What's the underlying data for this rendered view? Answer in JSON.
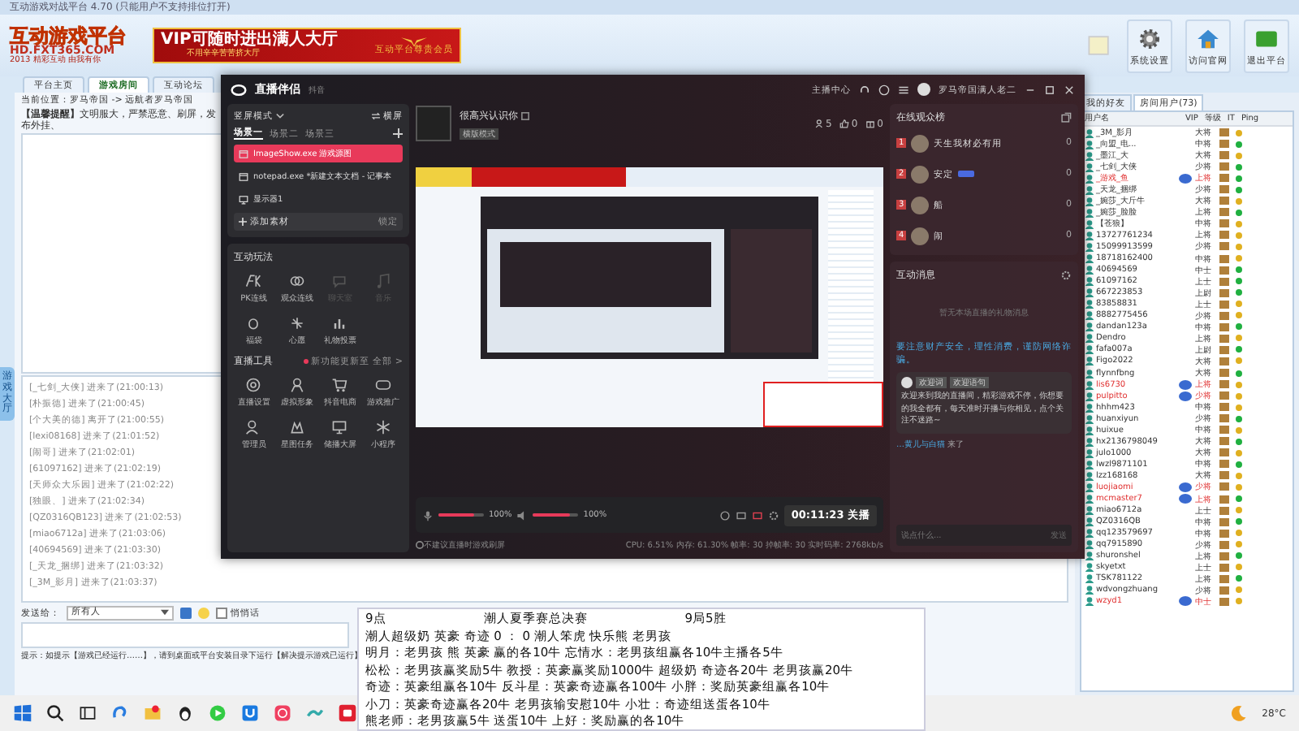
{
  "app": {
    "title": "互动游戏对战平台 4.70 (只能用户不支持排位打开)",
    "logo": {
      "name": "互动游戏平台",
      "site": "HD.FXT365.COM",
      "slogan": "2013 精彩互动 由我有你"
    },
    "banner": {
      "headline": "VIP可随时进出满人大厅",
      "subline": "不用辛辛苦苦挤大厅",
      "badge": "互动平台尊贵会员"
    },
    "toolbar": [
      {
        "label": "系统设置",
        "kind": "gear"
      },
      {
        "label": "访问官网",
        "kind": "home"
      },
      {
        "label": "退出平台",
        "kind": "exit"
      }
    ],
    "tabs": [
      {
        "label": "平台主页",
        "selected": false
      },
      {
        "label": "游戏房间",
        "selected": true
      },
      {
        "label": "互动论坛",
        "selected": false
      }
    ],
    "side_tab": "游戏大厅",
    "location": "当前位置：罗马帝国 -> 远航者罗马帝国",
    "notice": {
      "label": "【温馨提醒】",
      "text": "文明服大，严禁恶意、刷屏，发布外挂、"
    },
    "log": [
      "[_七剑_大侠] 进来了(21:00:13)",
      "[朴振德] 进来了(21:00:45)",
      "[个大美的德] 离开了(21:00:55)",
      "[lexi08168] 进来了(21:01:52)",
      "[闹哥] 进来了(21:02:01)",
      "[61097162] 进来了(21:02:19)",
      "[天师众大乐园] 进来了(21:02:22)",
      "[独眼、] 进来了(21:02:34)",
      "[QZ0316QB123] 进来了(21:02:53)",
      "[miao6712a] 进来了(21:03:06)",
      "[40694569] 进来了(21:03:30)",
      "[_天龙_捆绑] 进来了(21:03:32)",
      "[_3M_影月] 进来了(21:03:37)"
    ],
    "send": {
      "label": "发送给：",
      "value": "所有人",
      "whisper": {
        "label": "悄悄话",
        "checked": false
      }
    },
    "hint": "提示：如提示【游戏已经运行……】，请到桌面或平台安装目录下运行【解决提示游戏已运行】",
    "user_tabs": [
      {
        "label": "我的好友",
        "selected": false
      },
      {
        "label": "房间用户(73)",
        "selected": true
      }
    ],
    "user_columns": [
      "用户名",
      "VIP",
      "等级",
      "IT",
      "Ping"
    ],
    "users": [
      {
        "name": "_3M_影月",
        "level": "大将",
        "vip": false,
        "color": "#e0b020"
      },
      {
        "name": "_向盟_电...",
        "level": "中将",
        "vip": false,
        "color": "#20b040"
      },
      {
        "name": "_墨江_大",
        "level": "大将",
        "vip": false,
        "color": "#e0b020"
      },
      {
        "name": "_七剑_大侠",
        "level": "少将",
        "vip": false,
        "color": "#20b040"
      },
      {
        "name": "_游戏_鱼",
        "level": "上将",
        "vip": true,
        "color": "#20b040"
      },
      {
        "name": "_天龙_捆绑",
        "level": "少将",
        "vip": false,
        "color": "#20b040"
      },
      {
        "name": "_婉莎_大斤牛",
        "level": "大将",
        "vip": false,
        "color": "#e0b020"
      },
      {
        "name": "_婉莎_脸脸",
        "level": "上将",
        "vip": false,
        "color": "#20b040"
      },
      {
        "name": "【苍狼】",
        "level": "中将",
        "vip": false,
        "color": "#e0b020"
      },
      {
        "name": "13727761234",
        "level": "上将",
        "vip": false,
        "color": "#e0b020"
      },
      {
        "name": "15099913599",
        "level": "少将",
        "vip": false,
        "color": "#e0b020"
      },
      {
        "name": "18718162400",
        "level": "中将",
        "vip": false,
        "color": "#e0b020"
      },
      {
        "name": "40694569",
        "level": "中士",
        "vip": false,
        "color": "#20b040"
      },
      {
        "name": "61097162",
        "level": "上士",
        "vip": false,
        "color": "#20b040"
      },
      {
        "name": "667223853",
        "level": "上尉",
        "vip": false,
        "color": "#20b040"
      },
      {
        "name": "83858831",
        "level": "上士",
        "vip": false,
        "color": "#e0b020"
      },
      {
        "name": "8882775456",
        "level": "少将",
        "vip": false,
        "color": "#e0b020"
      },
      {
        "name": "dandan123a",
        "level": "中将",
        "vip": false,
        "color": "#20b040"
      },
      {
        "name": "Dendro",
        "level": "上将",
        "vip": false,
        "color": "#e0b020"
      },
      {
        "name": "fafa007a",
        "level": "上尉",
        "vip": false,
        "color": "#20b040"
      },
      {
        "name": "Figo2022",
        "level": "大将",
        "vip": false,
        "color": "#e0b020"
      },
      {
        "name": "flynnfbng",
        "level": "大将",
        "vip": false,
        "color": "#20b040"
      },
      {
        "name": "lis6730",
        "level": "上将",
        "vip": true,
        "color": "#e0b020"
      },
      {
        "name": "pulpitto",
        "level": "少将",
        "vip": true,
        "color": "#e0b020"
      },
      {
        "name": "hhhm423",
        "level": "中将",
        "vip": false,
        "color": "#e0b020"
      },
      {
        "name": "huanxiyun",
        "level": "少将",
        "vip": false,
        "color": "#20b040"
      },
      {
        "name": "huixue",
        "level": "中将",
        "vip": false,
        "color": "#e0b020"
      },
      {
        "name": "hx2136798049",
        "level": "大将",
        "vip": false,
        "color": "#20b040"
      },
      {
        "name": "julo1000",
        "level": "大将",
        "vip": false,
        "color": "#e0b020"
      },
      {
        "name": "lwzl9871101",
        "level": "中将",
        "vip": false,
        "color": "#20b040"
      },
      {
        "name": "lzz168168",
        "level": "大将",
        "vip": false,
        "color": "#e0b020"
      },
      {
        "name": "luojiaomi",
        "level": "少将",
        "vip": true,
        "color": "#e0b020"
      },
      {
        "name": "mcmaster7",
        "level": "上将",
        "vip": true,
        "color": "#20b040"
      },
      {
        "name": "miao6712a",
        "level": "上士",
        "vip": false,
        "color": "#e0b020"
      },
      {
        "name": "QZ0316QB",
        "level": "中将",
        "vip": false,
        "color": "#20b040"
      },
      {
        "name": "qq123579697",
        "level": "中将",
        "vip": false,
        "color": "#e0b020"
      },
      {
        "name": "qq7915890",
        "level": "少将",
        "vip": false,
        "color": "#e0b020"
      },
      {
        "name": "shuronshel",
        "level": "上将",
        "vip": false,
        "color": "#20b040"
      },
      {
        "name": "skyetxt",
        "level": "上士",
        "vip": false,
        "color": "#e0b020"
      },
      {
        "name": "TSK781122",
        "level": "上将",
        "vip": false,
        "color": "#20b040"
      },
      {
        "name": "wdvongzhuang",
        "level": "少将",
        "vip": false,
        "color": "#e0b020"
      },
      {
        "name": "wzyd1",
        "level": "中士",
        "vip": true,
        "color": "#e0b020"
      }
    ]
  },
  "streamer": {
    "brand": "直播伴侣",
    "platform": "抖音",
    "center": "主播中心",
    "user": "罗马帝国满人老二",
    "mode": "竖屏模式",
    "switch": "横屏",
    "scenes": [
      {
        "label": "场景一",
        "selected": true
      },
      {
        "label": "场景二",
        "selected": false
      },
      {
        "label": "场景三",
        "selected": false
      }
    ],
    "sources": [
      {
        "label": "ImageShow.exe 游戏源图",
        "kind": "window",
        "selected": true
      },
      {
        "label": "notepad.exe *新建文本文档 - 记事本",
        "kind": "window",
        "selected": false
      },
      {
        "label": "显示器1",
        "kind": "monitor",
        "selected": false
      }
    ],
    "add_source": "添加素材",
    "lock": "锁定",
    "play_title": "互动玩法",
    "play": [
      {
        "label": "PK连线",
        "kind": "pk",
        "disabled": false
      },
      {
        "label": "观众连线",
        "kind": "link",
        "disabled": false
      },
      {
        "label": "聊天室",
        "kind": "chat",
        "disabled": true
      },
      {
        "label": "音乐",
        "kind": "music",
        "disabled": true
      },
      {
        "label": "福袋",
        "kind": "bag",
        "disabled": false
      },
      {
        "label": "心愿",
        "kind": "wish",
        "disabled": false
      },
      {
        "label": "礼物投票",
        "kind": "vote",
        "disabled": false
      }
    ],
    "tools_title": "直播工具",
    "tools_note": "新功能更新至",
    "tools_all": "全部 >",
    "tools": [
      {
        "label": "直播设置",
        "kind": "settings"
      },
      {
        "label": "虚拟形象",
        "kind": "avatar"
      },
      {
        "label": "抖音电商",
        "kind": "cart"
      },
      {
        "label": "游戏推广",
        "kind": "gamepad"
      },
      {
        "label": "管理员",
        "kind": "admin"
      },
      {
        "label": "星图任务",
        "kind": "task"
      },
      {
        "label": "储播大屏",
        "kind": "screen"
      },
      {
        "label": "小程序",
        "kind": "app"
      }
    ],
    "room": {
      "title": "很高兴认识你",
      "tag": "横版模式"
    },
    "stats": [
      {
        "kind": "viewers",
        "value": "5"
      },
      {
        "kind": "likes",
        "value": "0"
      },
      {
        "kind": "gifts",
        "value": "0"
      }
    ],
    "mic": {
      "level": 0.8,
      "reading": "100%"
    },
    "speaker": {
      "level": 0.8,
      "reading": "100%"
    },
    "timer": "00:11:23",
    "end": "关播",
    "tip": "不建议直播时游戏刷屏",
    "perf": "CPU: 6.51%   内存: 61.30%   帧率: 30   掉帧率: 30   实时码率: 2768kb/s",
    "rank_title": "在线观众榜",
    "rank": [
      {
        "rank": "1",
        "name": "天生我材必有用",
        "badge": false,
        "score": "0"
      },
      {
        "rank": "2",
        "name": "安定",
        "badge": true,
        "score": "0"
      },
      {
        "rank": "3",
        "name": "船",
        "badge": false,
        "score": "0"
      },
      {
        "rank": "4",
        "name": "闹",
        "badge": false,
        "score": "0"
      }
    ],
    "msg_title": "互动消息",
    "msg_empty": "暂无本场直播的礼物消息",
    "safety": "要注意财产安全，理性消费，谨防网络诈骗。",
    "welcome": {
      "tags": [
        "欢迎词",
        "欢迎语句"
      ],
      "text": "欢迎来到我的直播间，精彩游戏不停，你想要的我全都有，每天准时开播与你相见，点个关注不迷路~"
    },
    "join": {
      "name": "…黄儿与白猫",
      "text": "来了"
    },
    "input": {
      "placeholder": "说点什么...",
      "send": "发送"
    }
  },
  "notepad": {
    "header": [
      "9点",
      "潮人夏季赛总决赛",
      "9局5胜"
    ],
    "lines": [
      "潮人超级奶  英豪  奇迹  0 ：  0  潮人笨虎  快乐熊  老男孩",
      "明月：老男孩 熊 英豪 赢的各10牛   忘情水：老男孩组赢各10牛主播各5牛",
      "松松：老男孩赢奖励5牛  教授：英豪赢奖励1000牛  超级奶  奇迹各20牛  老男孩赢20牛",
      "奇迹：英豪组赢各10牛  反斗星：英豪奇迹赢各100牛  小胖：奖励英豪组赢各10牛",
      " 小刀：英豪奇迹赢各20牛  老男孩输安慰10牛  小壮：奇迹组送蛋各10牛",
      "熊老师：老男孩赢5牛  送蛋10牛  上好：奖励赢的各10牛"
    ]
  },
  "taskbar": {
    "apps": [
      {
        "kind": "start"
      },
      {
        "kind": "search"
      },
      {
        "kind": "taskview"
      },
      {
        "kind": "swirl"
      },
      {
        "kind": "folder"
      },
      {
        "kind": "penguin"
      },
      {
        "kind": "play"
      },
      {
        "kind": "u"
      },
      {
        "kind": "heart"
      },
      {
        "kind": "tilde"
      },
      {
        "kind": "record"
      }
    ],
    "temperature": "28°C"
  }
}
